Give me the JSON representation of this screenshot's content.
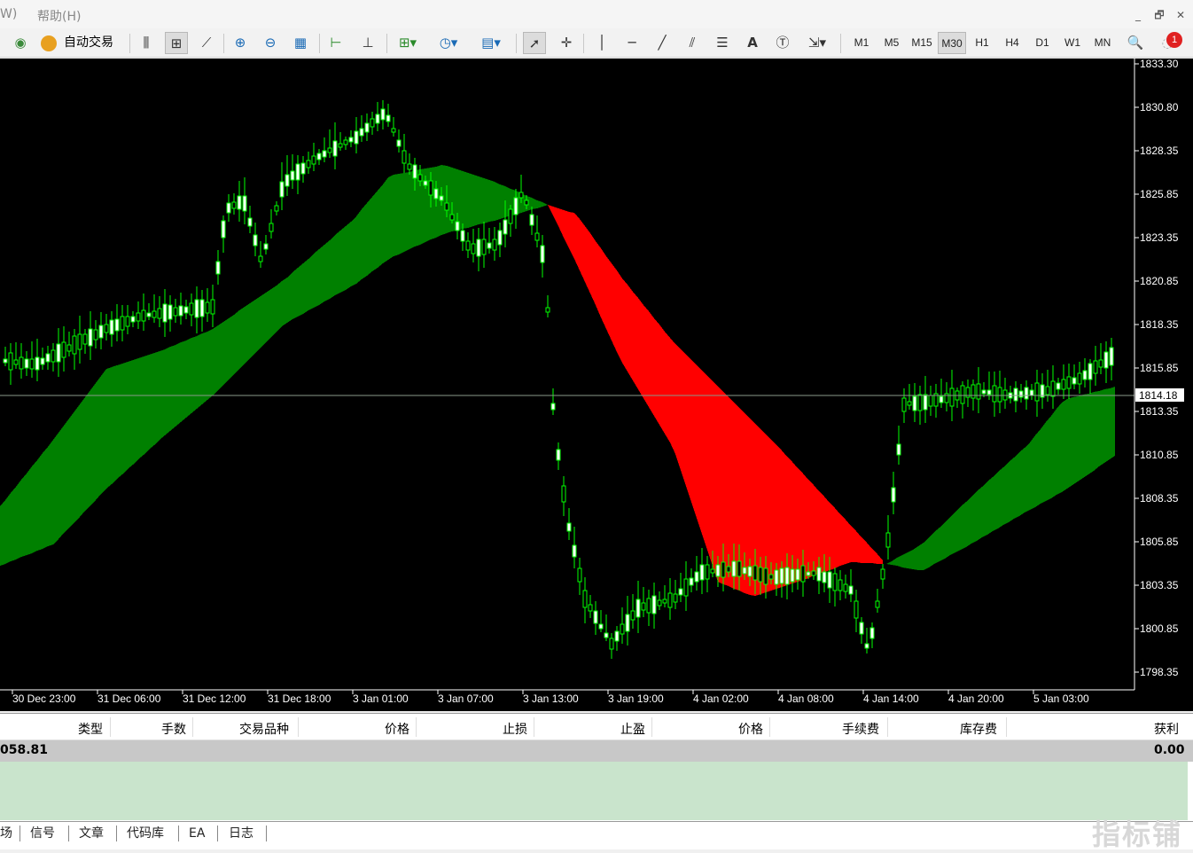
{
  "menubar": {
    "items": [
      "W)",
      "帮助(H)"
    ],
    "window_buttons": [
      "_",
      "🗗",
      "✕"
    ]
  },
  "toolbar": {
    "autotrade_label": "自动交易",
    "timeframes": [
      "M1",
      "M5",
      "M15",
      "M30",
      "H1",
      "H4",
      "D1",
      "W1",
      "MN"
    ],
    "active_timeframe": "M30",
    "alert_badge": "1"
  },
  "chart": {
    "current_price": "1814.18",
    "y_ticks": [
      "1833.30",
      "1830.80",
      "1828.35",
      "1825.85",
      "1823.35",
      "1820.85",
      "1818.35",
      "1815.85",
      "1813.35",
      "1810.85",
      "1808.35",
      "1805.85",
      "1803.35",
      "1800.85",
      "1798.35"
    ],
    "x_ticks": [
      "30 Dec 23:00",
      "31 Dec 06:00",
      "31 Dec 12:00",
      "31 Dec 18:00",
      "3 Jan 01:00",
      "3 Jan 07:00",
      "3 Jan 13:00",
      "3 Jan 19:00",
      "4 Jan 02:00",
      "4 Jan 08:00",
      "4 Jan 14:00",
      "4 Jan 20:00",
      "5 Jan 03:00"
    ],
    "colors": {
      "bull_band": "#008000",
      "bear_band": "#ff0000",
      "candle": "#00ff00",
      "background": "#000000"
    }
  },
  "terminal": {
    "columns": [
      "类型",
      "手数",
      "交易品种",
      "价格",
      "止损",
      "止盈",
      "价格",
      "手续费",
      "库存费",
      "获利"
    ],
    "balance_text": "058.81",
    "profit_total": "0.00"
  },
  "tabs": [
    "场",
    "信号",
    "文章",
    "代码库",
    "EA",
    "日志"
  ],
  "watermark": "指标铺"
}
